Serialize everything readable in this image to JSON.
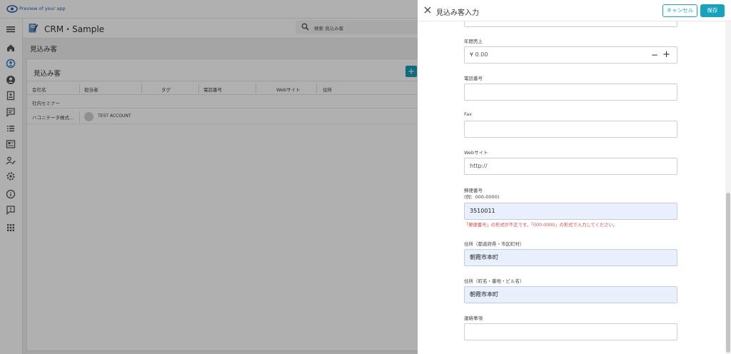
{
  "preview": {
    "text": "Preview of your app"
  },
  "app": {
    "title": "CRM・Sample",
    "search_placeholder": "検索 見込み客"
  },
  "sidebar": {
    "items": [
      {
        "icon": "home-icon"
      },
      {
        "icon": "user-circle-icon"
      },
      {
        "icon": "account-icon"
      },
      {
        "icon": "contact-card-icon"
      },
      {
        "icon": "chat-icon"
      },
      {
        "icon": "list-icon"
      },
      {
        "icon": "news-icon"
      },
      {
        "icon": "user-edit-icon"
      },
      {
        "icon": "settings-icon"
      },
      {
        "icon": "info-icon"
      },
      {
        "icon": "feedback-icon"
      },
      {
        "icon": "apps-grid-icon"
      }
    ]
  },
  "page": {
    "breadcrumb": "見込み客",
    "panel_title": "見込み客",
    "columns": [
      "会社名",
      "担当者",
      "タグ",
      "電話番号",
      "Webサイト",
      "住所"
    ],
    "group": "社内セミナー",
    "rows": [
      {
        "company": "ハコニテータ株式...",
        "owner": "TEST ACCOUNT"
      }
    ]
  },
  "drawer": {
    "title": "見込み客入力",
    "cancel": "キャンセル",
    "save": "保存",
    "revenue": {
      "label": "年間売上",
      "value": "¥ 0.00",
      "minus": "−",
      "plus": "+"
    },
    "phone": {
      "label": "電話番号",
      "value": ""
    },
    "fax": {
      "label": "Fax",
      "value": ""
    },
    "website": {
      "label": "Webサイト",
      "value": "http://"
    },
    "zip": {
      "label": "郵便番号",
      "hint": "(例：000-0000)",
      "value": "3510011",
      "error": "「郵便番号」の形式が不正です。「000-0000」の形式で入力してください。"
    },
    "address1": {
      "label": "住所（都道府県・市区町村）",
      "value": "朝霞市本町"
    },
    "address2": {
      "label": "住所（町名・番地・ビル名）",
      "value": "朝霞市本町"
    },
    "notes": {
      "label": "連絡事項",
      "value": ""
    }
  },
  "colors": {
    "accent": "#17a2bd",
    "error": "#e54545",
    "filled_bg": "#e8effd"
  }
}
